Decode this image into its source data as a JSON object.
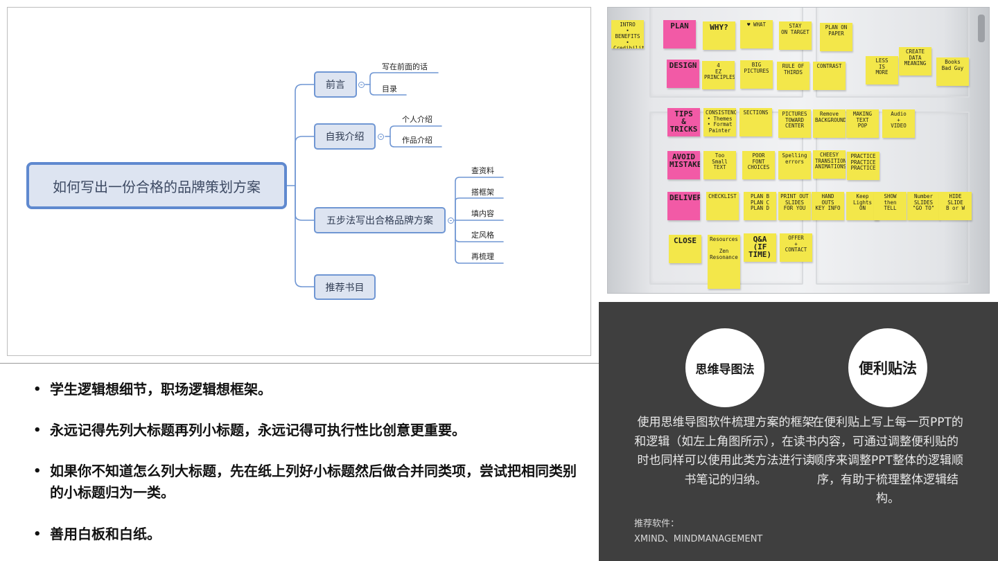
{
  "mindmap": {
    "root": "如何写出一份合格的品牌策划方案",
    "branches": [
      {
        "label": "前言",
        "children": [
          "写在前面的话",
          "目录"
        ]
      },
      {
        "label": "自我介绍",
        "children": [
          "个人介绍",
          "作品介绍"
        ]
      },
      {
        "label": "五步法写出合格品牌方案",
        "children": [
          "查资料",
          "搭框架",
          "填内容",
          "定风格",
          "再梳理"
        ]
      },
      {
        "label": "推荐书目",
        "children": []
      }
    ]
  },
  "sticky_notes": [
    {
      "text": "INTRO\n• BENEFITS\n• Credibility\n• Offers",
      "color": "yellow"
    },
    {
      "text": "PLAN",
      "color": "pink"
    },
    {
      "text": "WHY?",
      "color": "yellow"
    },
    {
      "text": "♥ WHAT",
      "color": "yellow"
    },
    {
      "text": "STAY\nON TARGET",
      "color": "yellow"
    },
    {
      "text": "PLAN ON\nPAPER",
      "color": "yellow"
    },
    {
      "text": "DESIGN",
      "color": "pink"
    },
    {
      "text": "4\nEZ\nPRINCIPLES",
      "color": "yellow"
    },
    {
      "text": "BIG\nPICTURES",
      "color": "yellow"
    },
    {
      "text": "RULE OF\nTHIRDS",
      "color": "yellow"
    },
    {
      "text": "CONTRAST",
      "color": "yellow"
    },
    {
      "text": "LESS\nIS\nMORE",
      "color": "yellow"
    },
    {
      "text": "CREATE\nDATA\nMEANING",
      "color": "yellow"
    },
    {
      "text": "Books\nBad Guy",
      "color": "yellow"
    },
    {
      "text": "TIPS\n&\nTRICKS",
      "color": "pink"
    },
    {
      "text": "CONSISTENCY\n• Themes\n• Format\n  Painter",
      "color": "yellow"
    },
    {
      "text": "SECTIONS",
      "color": "yellow"
    },
    {
      "text": "PICTURES\nTOWARD\nCENTER",
      "color": "yellow"
    },
    {
      "text": "Remove\nBACKGROUND",
      "color": "yellow"
    },
    {
      "text": "MAKING\nTEXT\nPOP",
      "color": "yellow"
    },
    {
      "text": "Audio\n+\nVIDEO",
      "color": "yellow"
    },
    {
      "text": "AVOID\nMISTAKES",
      "color": "pink"
    },
    {
      "text": "Too\nSmall\nTEXT",
      "color": "yellow"
    },
    {
      "text": "POOR\nFONT\nCHOICES",
      "color": "yellow"
    },
    {
      "text": "Spelling\nerrors",
      "color": "yellow"
    },
    {
      "text": "CHEESY\nTRANSITIONS\nANIMATIONS",
      "color": "yellow"
    },
    {
      "text": "PRACTICE\nPRACTICE\nPRACTICE",
      "color": "yellow"
    },
    {
      "text": "DELIVER",
      "color": "pink"
    },
    {
      "text": "CHECKLIST",
      "color": "yellow"
    },
    {
      "text": "PLAN B\nPLAN C\nPLAN D",
      "color": "yellow"
    },
    {
      "text": "PRINT OUT\nSLIDES\nFOR YOU",
      "color": "yellow"
    },
    {
      "text": "HAND\nOUTS\nKEY INFO",
      "color": "yellow"
    },
    {
      "text": "Keep\nLights\nON",
      "color": "yellow"
    },
    {
      "text": "SHOW\nthen\nTELL",
      "color": "yellow"
    },
    {
      "text": "Number\nSLIDES\n\"GO TO\"",
      "color": "yellow"
    },
    {
      "text": "HIDE\nSLIDE\nB or W",
      "color": "yellow"
    },
    {
      "text": "CLOSE",
      "color": "yellow"
    },
    {
      "text": "Resources\n\nZen\nResonance",
      "color": "yellow"
    },
    {
      "text": "Q&A\n(IF TIME)",
      "color": "yellow"
    },
    {
      "text": "OFFER\n+\nCONTACT",
      "color": "yellow"
    }
  ],
  "bullets": [
    "学生逻辑想细节，职场逻辑想框架。",
    "永远记得先列大标题再列小标题，永远记得可执行性比创意更重要。",
    "如果你不知道怎么列大标题，先在纸上列好小标题然后做合并同类项，尝试把相同类别的小标题归为一类。",
    "善用白板和白纸。"
  ],
  "methods": [
    {
      "title": "思维导图法",
      "description": "使用思维导图软件梳理方案的框架和逻辑（如左上角图所示），在读书时也同样可以使用此类方法进行读书笔记的归纳。"
    },
    {
      "title": "便利贴法",
      "description": "在便利贴上写上每一页PPT的内容，可通过调整便利贴的顺序来调整PPT整体的逻辑顺序，有助于梳理整体逻辑结构。"
    }
  ],
  "recommend": {
    "label": "推荐软件：",
    "software": "XMIND、MINDMANAGEMENT"
  },
  "colors": {
    "node_border": "#6f96d3",
    "node_fill": "#dde4f1",
    "root_border": "#5f89cf",
    "note_yellow": "#f3e74a",
    "note_pink": "#f25aa6",
    "dark_panel": "#3f3f3f"
  }
}
